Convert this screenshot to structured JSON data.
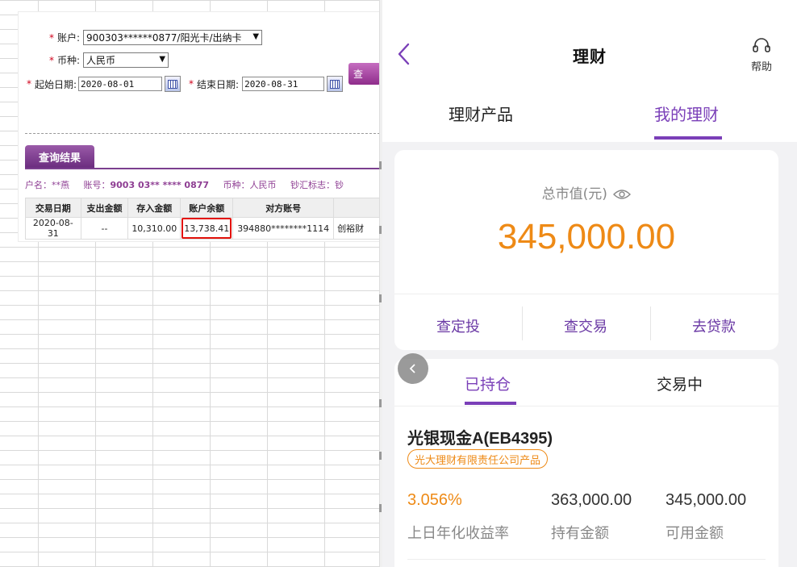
{
  "bank_form": {
    "account_label": "账户:",
    "account_value": "900303******0877/阳光卡/出纳卡",
    "currency_label": "币种:",
    "currency_value": "人民币",
    "start_label": "起始日期:",
    "start_value": "2020-08-01",
    "end_label": "结束日期:",
    "end_value": "2020-08-31",
    "query_button": "查"
  },
  "results": {
    "tab_label": "查询结果",
    "account_name": "户名：**燕",
    "account_no_label": "账号：",
    "account_no": "9003 03** **** 0877",
    "currency": "币种：人民币",
    "cash_flag": "钞汇标志：钞",
    "columns": [
      "交易日期",
      "支出金额",
      "存入金额",
      "账户余额",
      "对方账号",
      ""
    ],
    "rows": [
      [
        "2020-08-31",
        "--",
        "10,310.00",
        "13,738.41",
        "394880********1114",
        "创裕财"
      ]
    ]
  },
  "app": {
    "title": "理财",
    "help_label": "帮助",
    "tabs": [
      "理财产品",
      "我的理财"
    ],
    "active_tab": "我的理财",
    "total_label": "总市值(元)",
    "total_value": "345,000.00",
    "actions": [
      "查定投",
      "查交易",
      "去贷款"
    ],
    "holding_tabs": [
      "已持仓",
      "交易中"
    ],
    "product": {
      "name": "光银现金A(EB4395)",
      "issuer": "光大理财有限责任公司产品",
      "rate": "3.056%",
      "rate_label": "上日年化收益率",
      "holding_amount": "363,000.00",
      "holding_label": "持有金额",
      "available_amount": "345,000.00",
      "available_label": "可用金额"
    },
    "colors": {
      "accent": "#7a3fb8",
      "value": "#ee8a16",
      "bank_purple": "#8e3e93",
      "highlight": "#e3120b"
    }
  }
}
